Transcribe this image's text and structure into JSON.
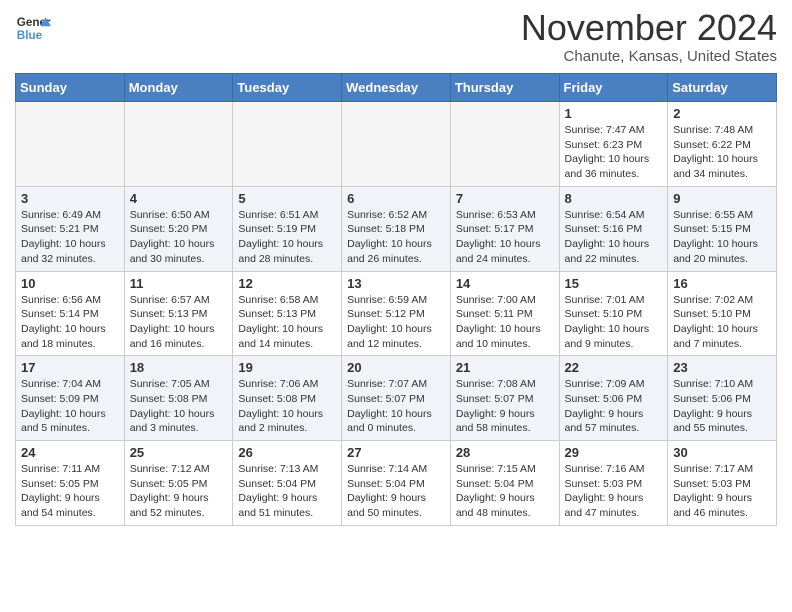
{
  "header": {
    "logo_line1": "General",
    "logo_line2": "Blue",
    "month": "November 2024",
    "location": "Chanute, Kansas, United States"
  },
  "days_of_week": [
    "Sunday",
    "Monday",
    "Tuesday",
    "Wednesday",
    "Thursday",
    "Friday",
    "Saturday"
  ],
  "weeks": [
    [
      {
        "day": "",
        "info": ""
      },
      {
        "day": "",
        "info": ""
      },
      {
        "day": "",
        "info": ""
      },
      {
        "day": "",
        "info": ""
      },
      {
        "day": "",
        "info": ""
      },
      {
        "day": "1",
        "info": "Sunrise: 7:47 AM\nSunset: 6:23 PM\nDaylight: 10 hours and 36 minutes."
      },
      {
        "day": "2",
        "info": "Sunrise: 7:48 AM\nSunset: 6:22 PM\nDaylight: 10 hours and 34 minutes."
      }
    ],
    [
      {
        "day": "3",
        "info": "Sunrise: 6:49 AM\nSunset: 5:21 PM\nDaylight: 10 hours and 32 minutes."
      },
      {
        "day": "4",
        "info": "Sunrise: 6:50 AM\nSunset: 5:20 PM\nDaylight: 10 hours and 30 minutes."
      },
      {
        "day": "5",
        "info": "Sunrise: 6:51 AM\nSunset: 5:19 PM\nDaylight: 10 hours and 28 minutes."
      },
      {
        "day": "6",
        "info": "Sunrise: 6:52 AM\nSunset: 5:18 PM\nDaylight: 10 hours and 26 minutes."
      },
      {
        "day": "7",
        "info": "Sunrise: 6:53 AM\nSunset: 5:17 PM\nDaylight: 10 hours and 24 minutes."
      },
      {
        "day": "8",
        "info": "Sunrise: 6:54 AM\nSunset: 5:16 PM\nDaylight: 10 hours and 22 minutes."
      },
      {
        "day": "9",
        "info": "Sunrise: 6:55 AM\nSunset: 5:15 PM\nDaylight: 10 hours and 20 minutes."
      }
    ],
    [
      {
        "day": "10",
        "info": "Sunrise: 6:56 AM\nSunset: 5:14 PM\nDaylight: 10 hours and 18 minutes."
      },
      {
        "day": "11",
        "info": "Sunrise: 6:57 AM\nSunset: 5:13 PM\nDaylight: 10 hours and 16 minutes."
      },
      {
        "day": "12",
        "info": "Sunrise: 6:58 AM\nSunset: 5:13 PM\nDaylight: 10 hours and 14 minutes."
      },
      {
        "day": "13",
        "info": "Sunrise: 6:59 AM\nSunset: 5:12 PM\nDaylight: 10 hours and 12 minutes."
      },
      {
        "day": "14",
        "info": "Sunrise: 7:00 AM\nSunset: 5:11 PM\nDaylight: 10 hours and 10 minutes."
      },
      {
        "day": "15",
        "info": "Sunrise: 7:01 AM\nSunset: 5:10 PM\nDaylight: 10 hours and 9 minutes."
      },
      {
        "day": "16",
        "info": "Sunrise: 7:02 AM\nSunset: 5:10 PM\nDaylight: 10 hours and 7 minutes."
      }
    ],
    [
      {
        "day": "17",
        "info": "Sunrise: 7:04 AM\nSunset: 5:09 PM\nDaylight: 10 hours and 5 minutes."
      },
      {
        "day": "18",
        "info": "Sunrise: 7:05 AM\nSunset: 5:08 PM\nDaylight: 10 hours and 3 minutes."
      },
      {
        "day": "19",
        "info": "Sunrise: 7:06 AM\nSunset: 5:08 PM\nDaylight: 10 hours and 2 minutes."
      },
      {
        "day": "20",
        "info": "Sunrise: 7:07 AM\nSunset: 5:07 PM\nDaylight: 10 hours and 0 minutes."
      },
      {
        "day": "21",
        "info": "Sunrise: 7:08 AM\nSunset: 5:07 PM\nDaylight: 9 hours and 58 minutes."
      },
      {
        "day": "22",
        "info": "Sunrise: 7:09 AM\nSunset: 5:06 PM\nDaylight: 9 hours and 57 minutes."
      },
      {
        "day": "23",
        "info": "Sunrise: 7:10 AM\nSunset: 5:06 PM\nDaylight: 9 hours and 55 minutes."
      }
    ],
    [
      {
        "day": "24",
        "info": "Sunrise: 7:11 AM\nSunset: 5:05 PM\nDaylight: 9 hours and 54 minutes."
      },
      {
        "day": "25",
        "info": "Sunrise: 7:12 AM\nSunset: 5:05 PM\nDaylight: 9 hours and 52 minutes."
      },
      {
        "day": "26",
        "info": "Sunrise: 7:13 AM\nSunset: 5:04 PM\nDaylight: 9 hours and 51 minutes."
      },
      {
        "day": "27",
        "info": "Sunrise: 7:14 AM\nSunset: 5:04 PM\nDaylight: 9 hours and 50 minutes."
      },
      {
        "day": "28",
        "info": "Sunrise: 7:15 AM\nSunset: 5:04 PM\nDaylight: 9 hours and 48 minutes."
      },
      {
        "day": "29",
        "info": "Sunrise: 7:16 AM\nSunset: 5:03 PM\nDaylight: 9 hours and 47 minutes."
      },
      {
        "day": "30",
        "info": "Sunrise: 7:17 AM\nSunset: 5:03 PM\nDaylight: 9 hours and 46 minutes."
      }
    ]
  ]
}
